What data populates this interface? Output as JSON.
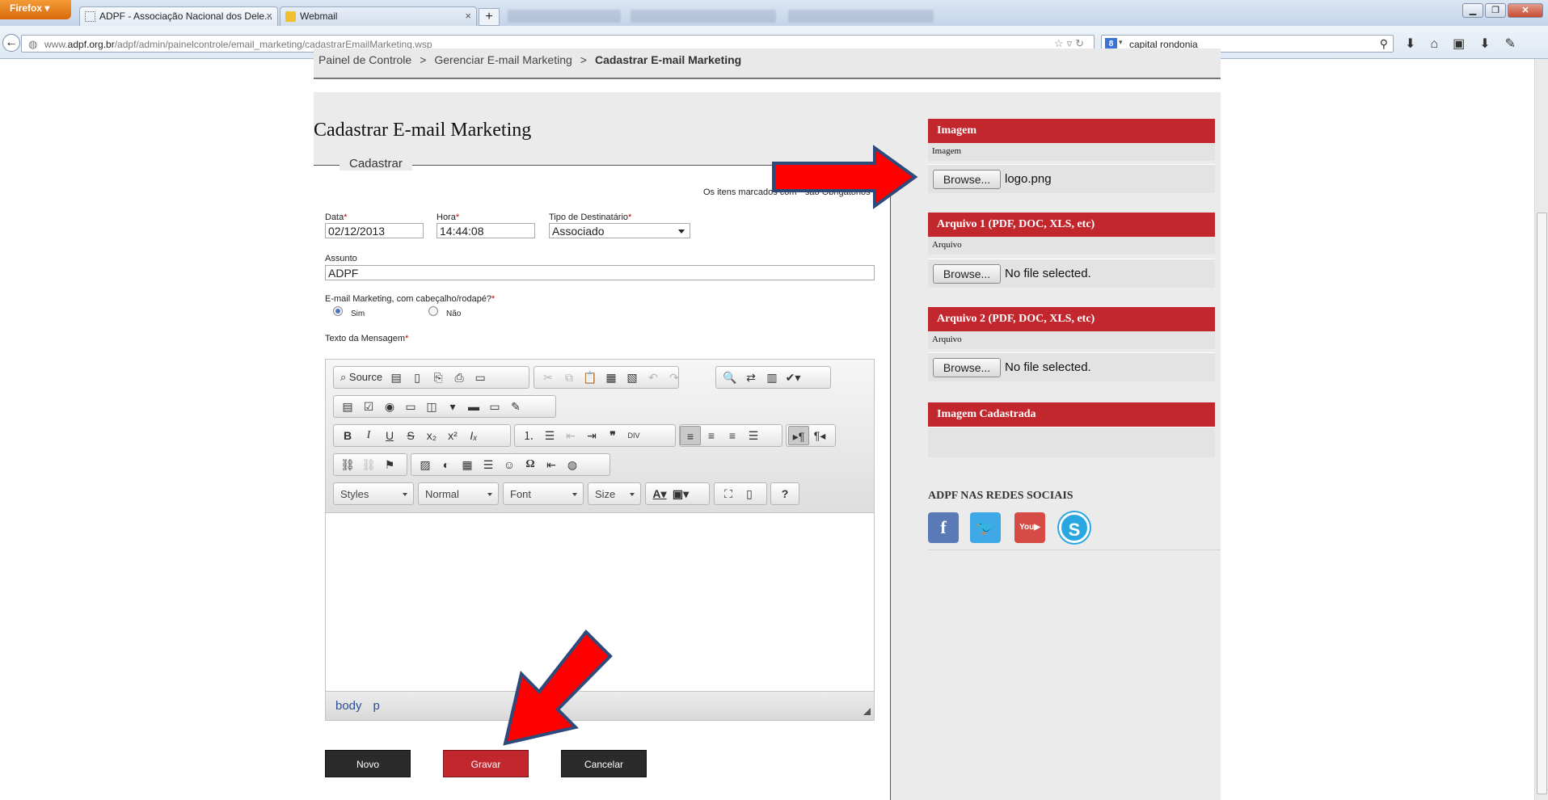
{
  "browser": {
    "menu_button": "Firefox",
    "tabs": [
      {
        "title": "ADPF - Associação Nacional dos Dele...",
        "close": "×"
      },
      {
        "title": "Webmail",
        "close": "×"
      }
    ],
    "new_tab": "+",
    "url_prefix": "www.",
    "url_domain": "adpf.org.br",
    "url_path": "/adpf/admin/painelcontrole/email_marketing/cadastrarEmailMarketing.wsp",
    "search_value": "capital rondonia"
  },
  "breadcrumb": {
    "items": [
      "Painel de Controle",
      "Gerenciar E-mail Marketing"
    ],
    "current": "Cadastrar E-mail Marketing",
    "separator": ">"
  },
  "form": {
    "title": "Cadastrar E-mail Marketing",
    "legend": "Cadastrar",
    "required_note": "Os itens marcados com * são Obrigatórios",
    "required_mark": "*",
    "data_label": "Data",
    "data_value": "02/12/2013",
    "hora_label": "Hora",
    "hora_value": "14:44:08",
    "tipo_label": "Tipo de Destinatário",
    "tipo_value": "Associado",
    "assunto_label": "Assunto",
    "assunto_value": "ADPF",
    "cabecalho_label": "E-mail Marketing, com cabeçalho/rodapé?",
    "radio_sim": "Sim",
    "radio_nao": "Não",
    "texto_label": "Texto da Mensagem",
    "buttons": {
      "novo": "Novo",
      "gravar": "Gravar",
      "cancelar": "Cancelar"
    }
  },
  "editor": {
    "source_label": "Source",
    "styles_combo": "Styles",
    "format_combo": "Normal",
    "font_combo": "Font",
    "size_combo": "Size",
    "status_path": [
      "body",
      "p"
    ]
  },
  "sidebar": {
    "imagem_head": "Imagem",
    "imagem_sub": "Imagem",
    "imagem_file": "logo.png",
    "arquivo1_head": "Arquivo 1 (PDF, DOC, XLS, etc)",
    "arquivo1_sub": "Arquivo",
    "arquivo1_file": "No file selected.",
    "arquivo2_head": "Arquivo 2 (PDF, DOC, XLS, etc)",
    "arquivo2_sub": "Arquivo",
    "arquivo2_file": "No file selected.",
    "cadastrada_head": "Imagem Cadastrada",
    "browse_label": "Browse...",
    "social_title": "ADPF NAS REDES SOCIAIS",
    "social_icons": [
      "facebook-icon",
      "twitter-icon",
      "youtube-icon",
      "skype-icon"
    ]
  },
  "colors": {
    "accent_red": "#c1272d",
    "dark_button": "#2b2b2b",
    "arrow_red": "#ff0000",
    "arrow_outline": "#2e4a7a"
  }
}
